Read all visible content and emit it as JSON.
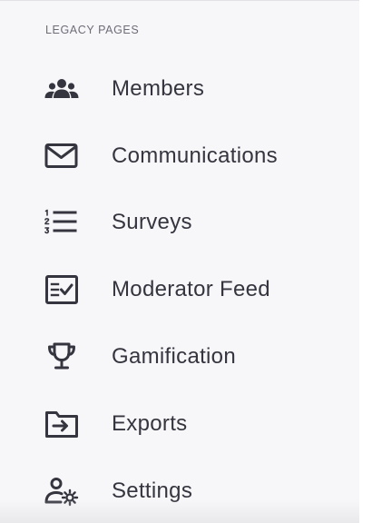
{
  "sidebar": {
    "section_label": "LEGACY PAGES",
    "items": [
      {
        "label": "Members",
        "icon": "members-icon"
      },
      {
        "label": "Communications",
        "icon": "envelope-icon"
      },
      {
        "label": "Surveys",
        "icon": "numbered-list-icon"
      },
      {
        "label": "Moderator Feed",
        "icon": "checklist-icon"
      },
      {
        "label": "Gamification",
        "icon": "trophy-icon"
      },
      {
        "label": "Exports",
        "icon": "folder-export-icon"
      },
      {
        "label": "Settings",
        "icon": "user-settings-icon"
      }
    ]
  },
  "colors": {
    "sidebar_background": "#f7f7f9",
    "text": "#35353f",
    "section_label": "#6d6d78"
  }
}
